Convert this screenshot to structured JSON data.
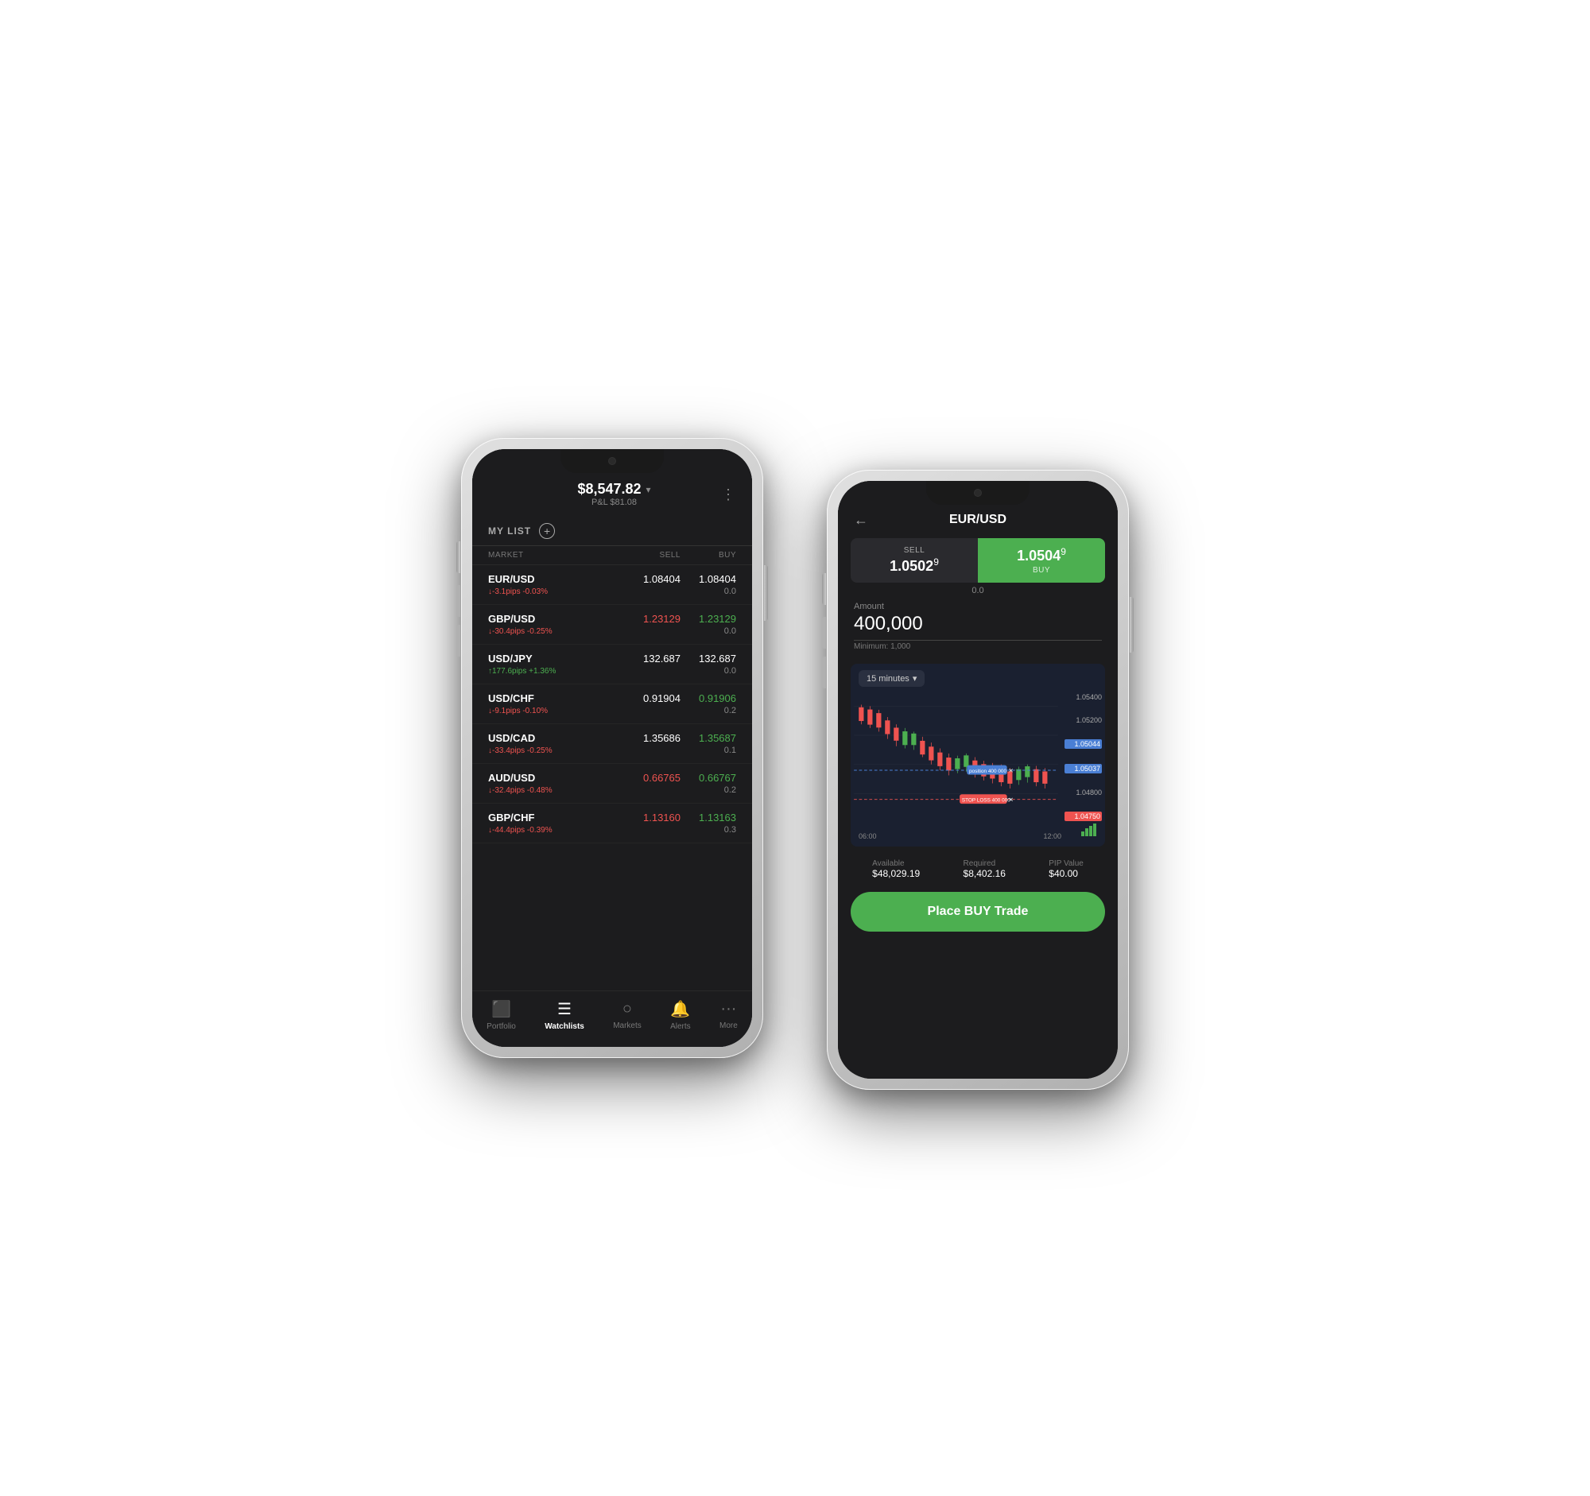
{
  "phone1": {
    "header": {
      "balance": "$8,547.82",
      "pl": "P&L $81.08",
      "chevron": "▾",
      "more": "⋮"
    },
    "list": {
      "title": "MY LIST",
      "add_icon": "+"
    },
    "columns": {
      "market": "MARKET",
      "sell": "SELL",
      "buy": "BUY"
    },
    "markets": [
      {
        "name": "EUR/USD",
        "sell": "1.08404",
        "buy": "1.08404",
        "change": "↓-3.1pips -0.03%",
        "change_type": "down",
        "spread": "0.0"
      },
      {
        "name": "GBP/USD",
        "sell": "1.23129",
        "buy": "1.23129",
        "change": "↓-30.4pips -0.25%",
        "change_type": "down",
        "spread": "0.0"
      },
      {
        "name": "USD/JPY",
        "sell": "132.687",
        "buy": "132.687",
        "change": "↑177.6pips +1.36%",
        "change_type": "up",
        "spread": "0.0"
      },
      {
        "name": "USD/CHF",
        "sell": "0.91904",
        "buy": "0.91906",
        "change": "↓-9.1pips -0.10%",
        "change_type": "down",
        "spread": "0.2"
      },
      {
        "name": "USD/CAD",
        "sell": "1.35686",
        "buy": "1.35687",
        "change": "↓-33.4pips -0.25%",
        "change_type": "down",
        "spread": "0.1"
      },
      {
        "name": "AUD/USD",
        "sell": "0.66765",
        "buy": "0.66767",
        "change": "↓-32.4pips -0.48%",
        "change_type": "down",
        "spread": "0.2"
      },
      {
        "name": "GBP/CHF",
        "sell": "1.13160",
        "buy": "1.13163",
        "change": "↓-44.4pips -0.39%",
        "change_type": "down",
        "spread": "0.3"
      }
    ],
    "nav": {
      "items": [
        {
          "label": "Portfolio",
          "icon": "🗂",
          "active": false
        },
        {
          "label": "Watchlists",
          "icon": "📋",
          "active": true
        },
        {
          "label": "Markets",
          "icon": "🔍",
          "active": false
        },
        {
          "label": "Alerts",
          "icon": "🔔",
          "active": false
        },
        {
          "label": "More",
          "icon": "···",
          "active": false
        }
      ]
    }
  },
  "phone2": {
    "header": {
      "back": "←",
      "title": "EUR/USD"
    },
    "prices": {
      "sell_label": "SELL",
      "sell_price": "1.0502",
      "sell_superscript": "9",
      "buy_label": "BUY",
      "buy_price": "1.0504",
      "buy_superscript": "9",
      "spread": "0.0"
    },
    "amount": {
      "label": "Amount",
      "value": "400,000",
      "minimum": "Minimum: 1,000"
    },
    "chart": {
      "timeframe": "15 minutes",
      "price_levels": [
        "1.05400",
        "1.05200",
        "1.04800"
      ],
      "position_price": "1.05044",
      "position_price2": "1.05037",
      "stop_price": "1.04750",
      "position_label": "position",
      "position_amount": "400 000",
      "stop_label": "STOP LOSS",
      "stop_amount": "400 000",
      "times": [
        "06:00",
        "12:00"
      ]
    },
    "stats": {
      "available_label": "Available",
      "available_value": "$48,029.19",
      "required_label": "Required",
      "required_value": "$8,402.16",
      "pip_label": "PIP Value",
      "pip_value": "$40.00"
    },
    "buy_button": "Place BUY Trade"
  }
}
